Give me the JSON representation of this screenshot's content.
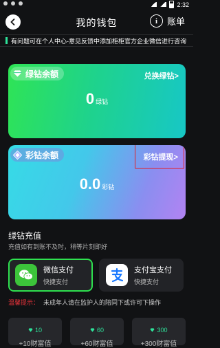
{
  "status_bar": {
    "time": "2:32"
  },
  "header": {
    "title": "我的钱包",
    "bill_label": "账单"
  },
  "notice": {
    "text": "有问题可在个人中心-意见反馈中添加柜柜官方企业微信进行咨询"
  },
  "green_card": {
    "label": "绿钻余额",
    "link": "兑换绿钻>",
    "amount": "0",
    "unit": "绿钻"
  },
  "color_card": {
    "label": "彩钻余额",
    "link": "彩钻提现>",
    "amount": "0.0",
    "unit": "彩钻"
  },
  "recharge": {
    "title": "绿钻充值",
    "subtitle": "充值如有到账不及时，稍等片刻即好"
  },
  "payments": [
    {
      "name": "微信支付",
      "desc": "快捷支付"
    },
    {
      "name": "支付宝支付",
      "desc": "快捷支付"
    }
  ],
  "tip": {
    "label": "温馨提示：",
    "text": "未成年人请在监护人的陪同下或许可下操作"
  },
  "packages": [
    {
      "diamonds": "10",
      "bonus": "+10财富值"
    },
    {
      "diamonds": "60",
      "bonus": "+60财富值"
    },
    {
      "diamonds": "300",
      "bonus": "+300财富值"
    }
  ],
  "colors": {
    "accent_green": "#2ee24f",
    "highlight_red": "#e31e24",
    "tip_red": "#e8333a"
  }
}
